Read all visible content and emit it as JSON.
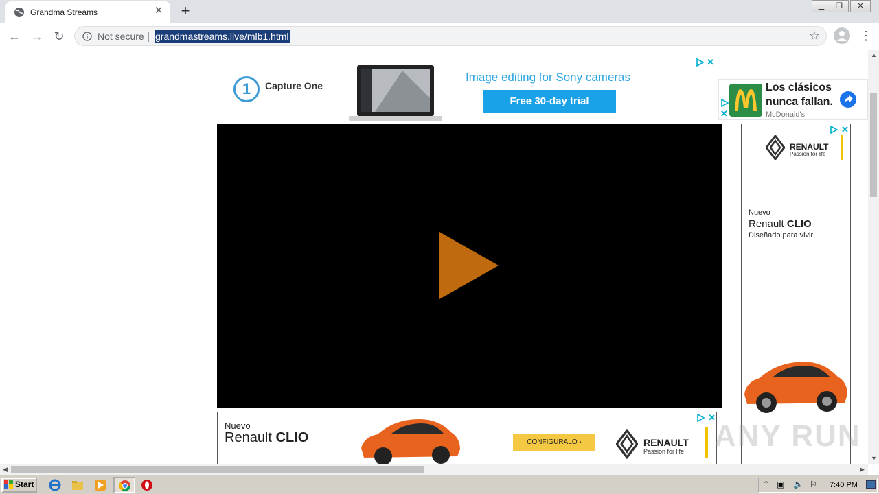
{
  "browser": {
    "tab_title": "Grandma Streams",
    "new_tab_label": "+",
    "security_label": "Not secure",
    "url": "grandmastreams.live/mlb1.html"
  },
  "top_ad": {
    "brand": "Capture One",
    "headline": "Image editing for Sony cameras",
    "cta": "Free 30-day trial"
  },
  "mcdonalds_ad": {
    "line1": "Los clásicos",
    "line2": "nunca fallan.",
    "advertiser": "McDonald's"
  },
  "side_ad": {
    "brand": "RENAULT",
    "tagline": "Passion for life",
    "nuevo": "Nuevo",
    "model_prefix": "Renault ",
    "model_bold": "CLIO",
    "tag": "Diseñado para vivir"
  },
  "bottom_ad": {
    "nuevo": "Nuevo",
    "model_prefix": "Renault ",
    "model_bold": "CLIO",
    "cta": "CONFIGÚRALO ›",
    "brand": "RENAULT",
    "tagline": "Passion for life"
  },
  "watermark": "ANY RUN",
  "taskbar": {
    "start_label": "Start",
    "clock": "7:40 PM"
  },
  "colors": {
    "play_button": "#c06a10",
    "url_highlight": "#1c3e78",
    "cta_blue": "#1aa2e8"
  }
}
